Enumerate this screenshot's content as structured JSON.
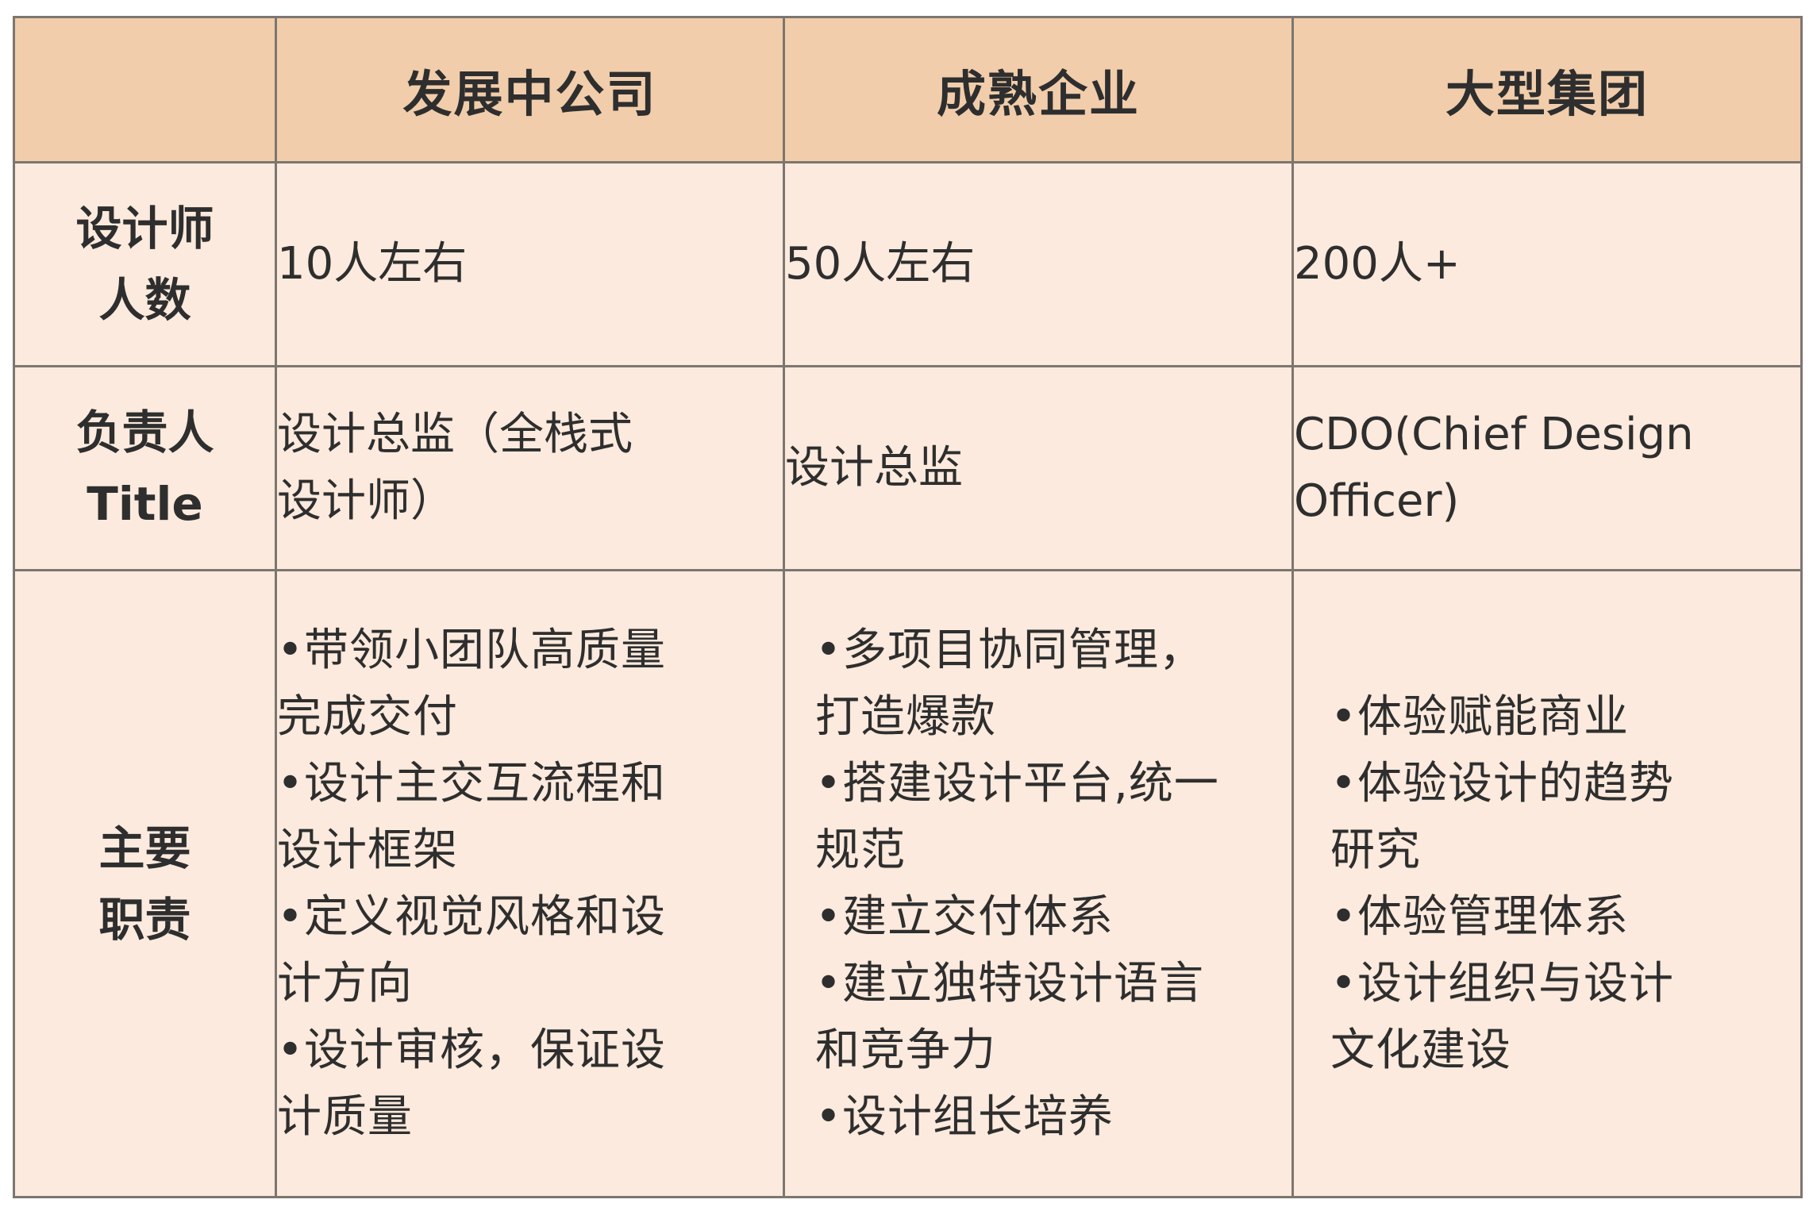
{
  "table": {
    "header": {
      "corner": "",
      "columns": [
        "发展中公司",
        "成熟企业",
        "大型集团"
      ]
    },
    "rows": {
      "designer_count": {
        "label_lines": [
          "设计师",
          "人数"
        ],
        "cells": [
          "10人左右",
          "50人左右",
          "200人+"
        ]
      },
      "leader_title": {
        "label_lines": [
          "负责人",
          "Title"
        ],
        "cells": [
          [
            "设计总监（全栈式",
            "设计师）"
          ],
          [
            "设计总监"
          ],
          [
            "CDO(Chief Design",
            "Officer)"
          ]
        ]
      },
      "main_duties": {
        "label_lines": [
          "主要",
          "职责"
        ],
        "cells": [
          [
            "•带领小团队高质量",
            "完成交付",
            "•设计主交互流程和",
            "设计框架",
            "•定义视觉风格和设",
            "计方向",
            "•设计审核，保证设",
            "计质量"
          ],
          [
            "•多项目协同管理，",
            "打造爆款",
            "•搭建设计平台,统一",
            "规范",
            "•建立交付体系",
            "•建立独特设计语言",
            "和竞争力",
            "•设计组长培养"
          ],
          [
            "•体验赋能商业",
            "•体验设计的趋势",
            "研究",
            "•体验管理体系",
            "•设计组织与设计",
            "文化建设"
          ]
        ]
      }
    }
  },
  "colors": {
    "header_bg": "#f1cdab",
    "cell_bg": "#fbeadd",
    "border": "#7d7670",
    "text": "#2e2e2e"
  }
}
